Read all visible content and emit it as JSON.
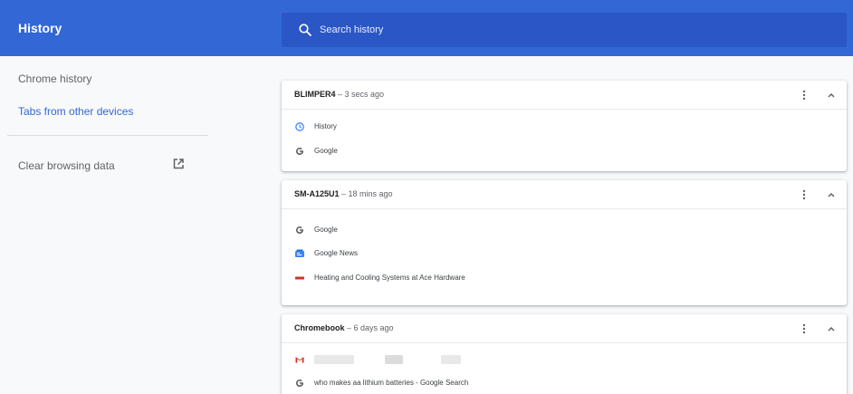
{
  "header": {
    "title": "History"
  },
  "search": {
    "placeholder": "Search history"
  },
  "sidebar": {
    "items": [
      {
        "label": "Chrome history"
      },
      {
        "label": "Tabs from other devices"
      }
    ],
    "clear_label": "Clear browsing data"
  },
  "devices": [
    {
      "name": "BLIMPER4",
      "time": " – 3 secs ago",
      "entries": [
        {
          "icon": "history-clock-icon",
          "title": "History"
        },
        {
          "icon": "google-favicon",
          "title": "Google"
        }
      ]
    },
    {
      "name": "SM-A125U1",
      "time": " – 18 mins ago",
      "entries": [
        {
          "icon": "google-favicon",
          "title": "Google"
        },
        {
          "icon": "google-news-favicon",
          "title": "Google News"
        },
        {
          "icon": "ace-hardware-favicon",
          "title": "Heating and Cooling Systems at Ace Hardware"
        }
      ]
    },
    {
      "name": "Chromebook",
      "time": " – 6 days ago",
      "entries": [
        {
          "icon": "gmail-favicon",
          "title": ""
        },
        {
          "icon": "google-favicon",
          "title": "who makes aa lithium batteries - Google Search"
        }
      ]
    }
  ],
  "colors": {
    "toolbar": "#3367d6",
    "search_bg": "#2a56c6",
    "link": "#3367d6"
  }
}
